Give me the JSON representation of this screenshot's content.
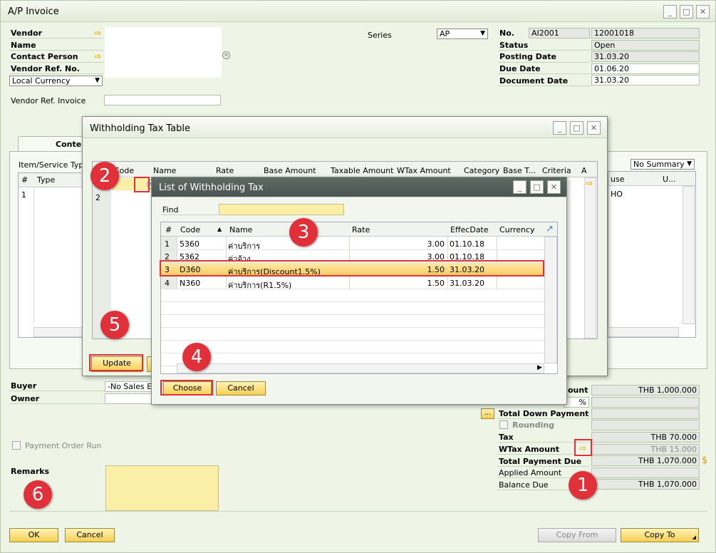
{
  "window": {
    "title": "A/P Invoice",
    "min": "_",
    "max": "□",
    "close": "✕"
  },
  "header": {
    "vendor_label": "Vendor",
    "name_label": "Name",
    "contact_label": "Contact Person",
    "vendor_ref_label": "Vendor Ref. No.",
    "currency_value": "Local Currency",
    "vendor_ref_invoice_label": "Vendor Ref. Invoice",
    "series_label": "Series",
    "series_value": "AP",
    "no_label": "No.",
    "no_prefix": "AI2001",
    "no_value": "12001018",
    "status_label": "Status",
    "status_value": "Open",
    "posting_label": "Posting Date",
    "posting_value": "31.03.20",
    "due_label": "Due Date",
    "due_value": "01.06.20",
    "doc_label": "Document Date",
    "doc_value": "31.03.20"
  },
  "tabs": {
    "contents": "Contents"
  },
  "content": {
    "item_type_label": "Item/Service Type",
    "summary_value": "No Summary",
    "cols": [
      "#",
      "Type"
    ],
    "row1": "1",
    "right_cols": [
      "use",
      "U..."
    ],
    "right_cell": "HO"
  },
  "bottom": {
    "buyer_label": "Buyer",
    "buyer_value": "-No Sales Em",
    "owner_label": "Owner",
    "payment_order_label": "Payment Order Run",
    "remarks_label": "Remarks",
    "ok": "OK",
    "cancel": "Cancel",
    "copy_from": "Copy From",
    "copy_to": "Copy To"
  },
  "totals": {
    "discount_label": "ount",
    "discount_value": "THB 1,000.000",
    "pct": "%",
    "dp_btn": "...",
    "down_payment_label": "Total Down Payment",
    "rounding_label": "Rounding",
    "tax_label": "Tax",
    "tax_value": "THB 70.000",
    "wtax_label": "WTax Amount",
    "wtax_value": "THB 15.000",
    "total_due_label": "Total Payment Due",
    "total_due_value": "THB 1,070.000",
    "applied_label": "Applied Amount",
    "balance_label": "Balance Due",
    "balance_value": "THB 1,070.000"
  },
  "wtt": {
    "title": "Withholding Tax Table",
    "cols": [
      "#",
      "Code",
      "Name",
      "Rate",
      "Base Amount",
      "Taxable Amount",
      "WTax Amount",
      "Category",
      "Base T...",
      "Criteria",
      "A"
    ],
    "rows": [
      "1",
      "2"
    ],
    "update": "Update"
  },
  "lwt": {
    "title": "List of Withholding Tax",
    "find_label": "Find",
    "cols": {
      "num": "#",
      "code": "Code",
      "name": "Name",
      "rate": "Rate",
      "effec": "EffecDate",
      "currency": "Currency"
    },
    "rows": [
      {
        "n": "1",
        "code": "5360",
        "name": "ค่าบริการ",
        "rate": "3.00",
        "date": "01.10.18"
      },
      {
        "n": "2",
        "code": "5362",
        "name": "ค่าจ้าง",
        "rate": "3.00",
        "date": "01.10.18"
      },
      {
        "n": "3",
        "code": "D360",
        "name": "ค่าบริการ(Discount1.5%)",
        "rate": "1.50",
        "date": "31.03.20"
      },
      {
        "n": "4",
        "code": "N360",
        "name": "ค่าบริการ(R1.5%)",
        "rate": "1.50",
        "date": "31.03.20"
      }
    ],
    "choose": "Choose",
    "cancel": "Cancel"
  },
  "callouts": [
    "1",
    "2",
    "3",
    "4",
    "5",
    "6"
  ]
}
